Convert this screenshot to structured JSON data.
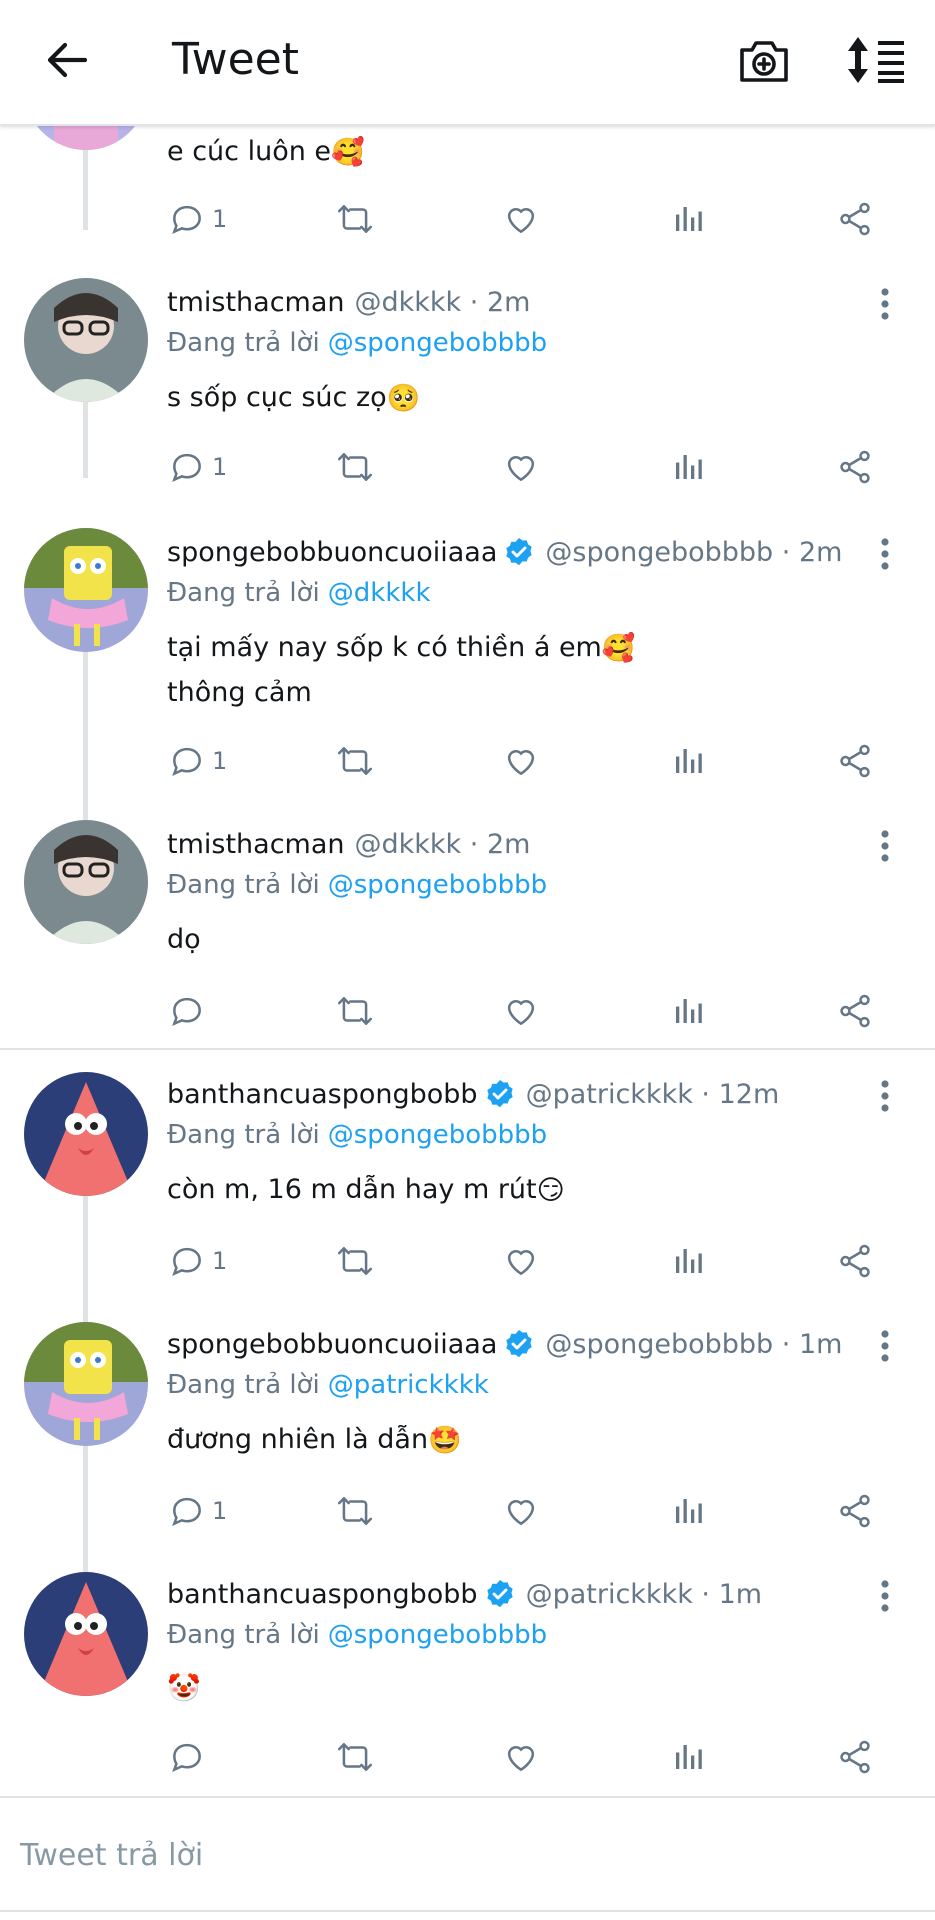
{
  "header": {
    "title": "Tweet",
    "back_icon": "arrow-left-icon",
    "camera_icon": "camera-plus-icon",
    "sort_icon": "sort-list-icon"
  },
  "colors": {
    "link": "#1da1f2",
    "muted": "#657786",
    "line": "#dfe3e6"
  },
  "tweets": [
    {
      "content_lines": [
        "e cúc luôn e"
      ],
      "emoji": "🥰",
      "reply_count": "1"
    },
    {
      "name": "tmisthacman",
      "handle": "@dkkkk · 2m",
      "reply_prefix": "Đang trả lời",
      "mention": "@spongebobbbb",
      "content_lines": [
        "s sốp cục súc zọ"
      ],
      "emoji": "🥺",
      "reply_count": "1"
    },
    {
      "name": "spongebobbuoncuoiiaaa",
      "handle": "@spongebobbbb · 2m",
      "reply_prefix": "Đang trả lời",
      "mention": "@dkkkk",
      "content_lines": [
        "tại mấy nay sốp k có thiền á em",
        "thông cảm"
      ],
      "emoji": "🥰",
      "reply_count": "1"
    },
    {
      "name": "tmisthacman",
      "handle": "@dkkkk · 2m",
      "reply_prefix": "Đang trả lời",
      "mention": "@spongebobbbb",
      "content_lines": [
        "dọ"
      ],
      "reply_count": ""
    },
    {
      "name": "banthancuaspongbobb",
      "handle": "@patrickkkk · 12m",
      "reply_prefix": "Đang trả lời",
      "mention": "@spongebobbbb",
      "content_lines": [
        "còn m, 16 m dẫn hay m rút"
      ],
      "emoji": "😏",
      "reply_count": "1"
    },
    {
      "name": "spongebobbuoncuoiiaaa",
      "handle": "@spongebobbbb · 1m",
      "reply_prefix": "Đang trả lời",
      "mention": "@patrickkkk",
      "content_lines": [
        "đương nhiên là dẫn"
      ],
      "emoji": "🤩",
      "reply_count": "1"
    },
    {
      "name": "banthancuaspongbobb",
      "handle": "@patrickkkk · 1m",
      "reply_prefix": "Đang trả lời",
      "mention": "@spongebobbbb",
      "content_lines": [
        ""
      ],
      "emoji": "🤡",
      "reply_count": ""
    }
  ],
  "composer": {
    "placeholder": "Tweet trả lời"
  }
}
